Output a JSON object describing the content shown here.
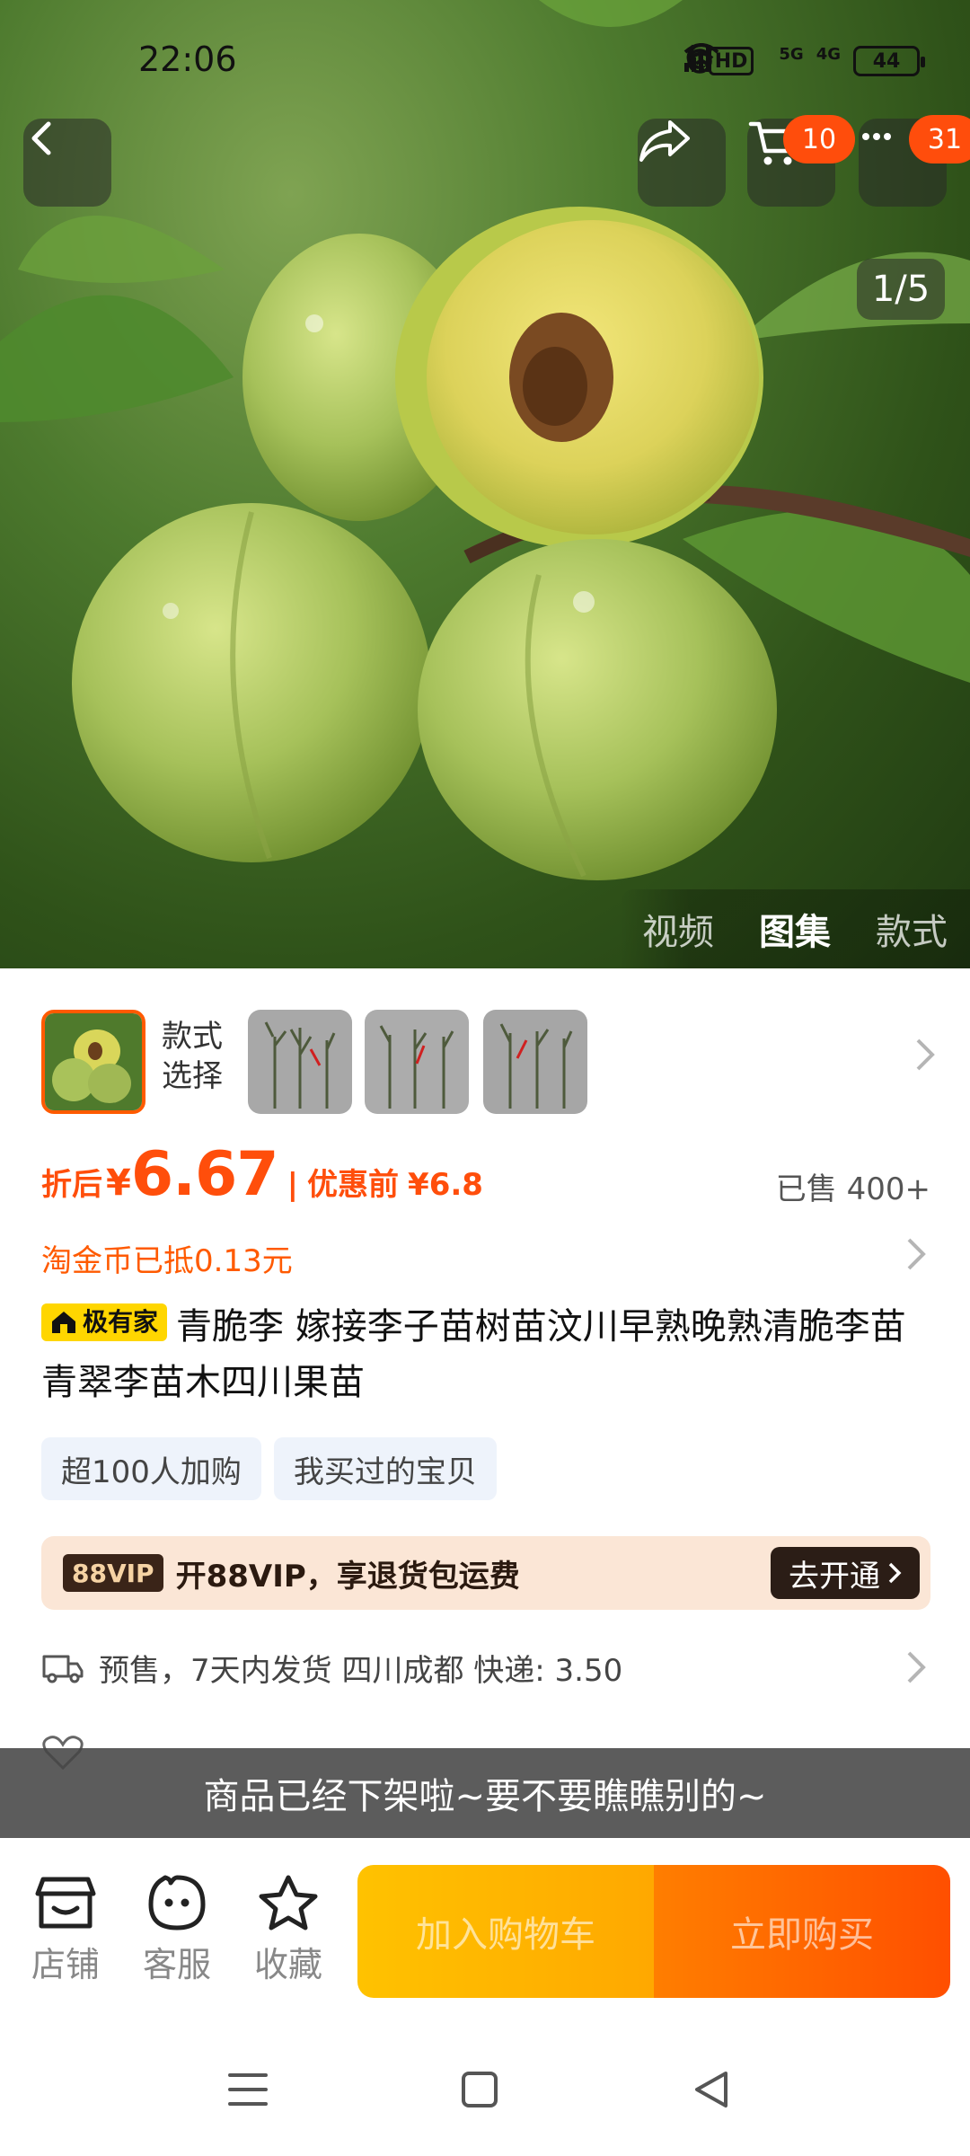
{
  "status_bar": {
    "time": "22:06",
    "network_hd": "HD",
    "network_5g": "5G",
    "network_4g": "4G",
    "battery": "44"
  },
  "top_buttons": {
    "cart_badge": "10",
    "more_badge": "31"
  },
  "gallery": {
    "counter": "1/5",
    "tabs": [
      "视频",
      "图集",
      "款式"
    ],
    "active_tab": "图集"
  },
  "sku": {
    "label_line1": "款式",
    "label_line2": "选择"
  },
  "price": {
    "prefix": "折后",
    "currency": "¥",
    "current": "6.67",
    "separator": "|",
    "before_label": "优惠前",
    "before_value": "¥6.8",
    "sold": "已售 400+"
  },
  "coin": {
    "text": "淘金币已抵0.13元"
  },
  "title": {
    "brand_tag": "极有家",
    "text": "青脆李 嫁接李子苗树苗汶川早熟晚熟清脆李苗 青翠李苗木四川果苗"
  },
  "chips": [
    "超100人加购",
    "我买过的宝贝"
  ],
  "vip": {
    "badge": "88VIP",
    "text": "开88VIP，享退货包运费",
    "button": "去开通"
  },
  "shipping": {
    "text": "预售，7天内发货  四川成都  快递: 3.50"
  },
  "offline_banner": "商品已经下架啦~要不要瞧瞧别的~",
  "actions": {
    "store": "店铺",
    "service": "客服",
    "favorite": "收藏",
    "add_to_cart": "加入购物车",
    "buy_now": "立即购买"
  },
  "colors": {
    "accent": "#ff4e0b",
    "vip_bg": "#fbe6d6",
    "cart_btn": "#ffb300",
    "buy_btn": "#ff5a00"
  }
}
